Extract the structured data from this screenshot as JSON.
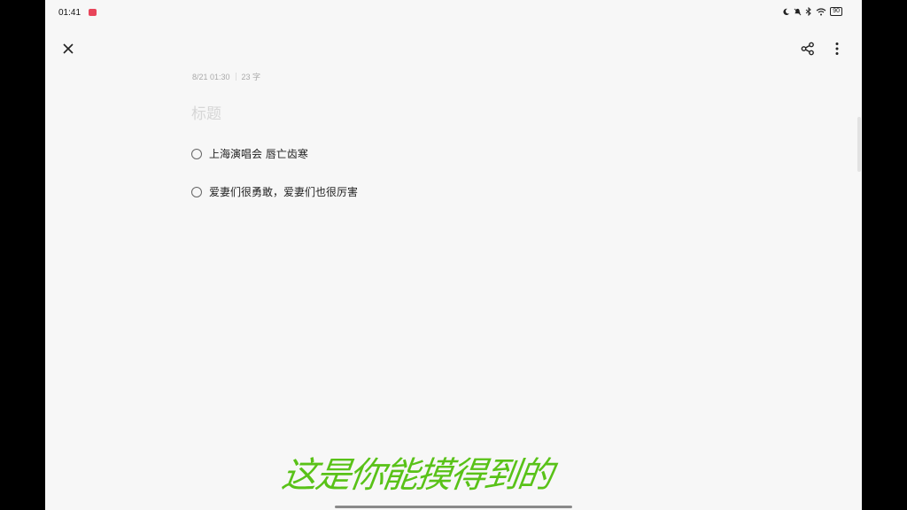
{
  "status_bar": {
    "time": "01:41",
    "battery": "90",
    "icons": [
      "moon-icon",
      "mute-icon",
      "bluetooth-icon",
      "wifi-icon",
      "battery-icon"
    ]
  },
  "toolbar": {
    "close_icon": "close-icon",
    "share_icon": "share-icon",
    "more_icon": "more-vertical-icon"
  },
  "note": {
    "date": "8/21 01:30",
    "word_count": "23 字",
    "title_placeholder": "标题",
    "todos": [
      {
        "text": "上海演唱会 唇亡齿寒",
        "checked": false
      },
      {
        "text": "爱妻们很勇敢，爱妻们也很厉害",
        "checked": false
      }
    ]
  },
  "overlay": {
    "watermark_text": "这是你能摸得到的",
    "watermark_color": "#59c218"
  },
  "colors": {
    "background": "#f7f7f7",
    "app_badge": "#e8455a"
  }
}
